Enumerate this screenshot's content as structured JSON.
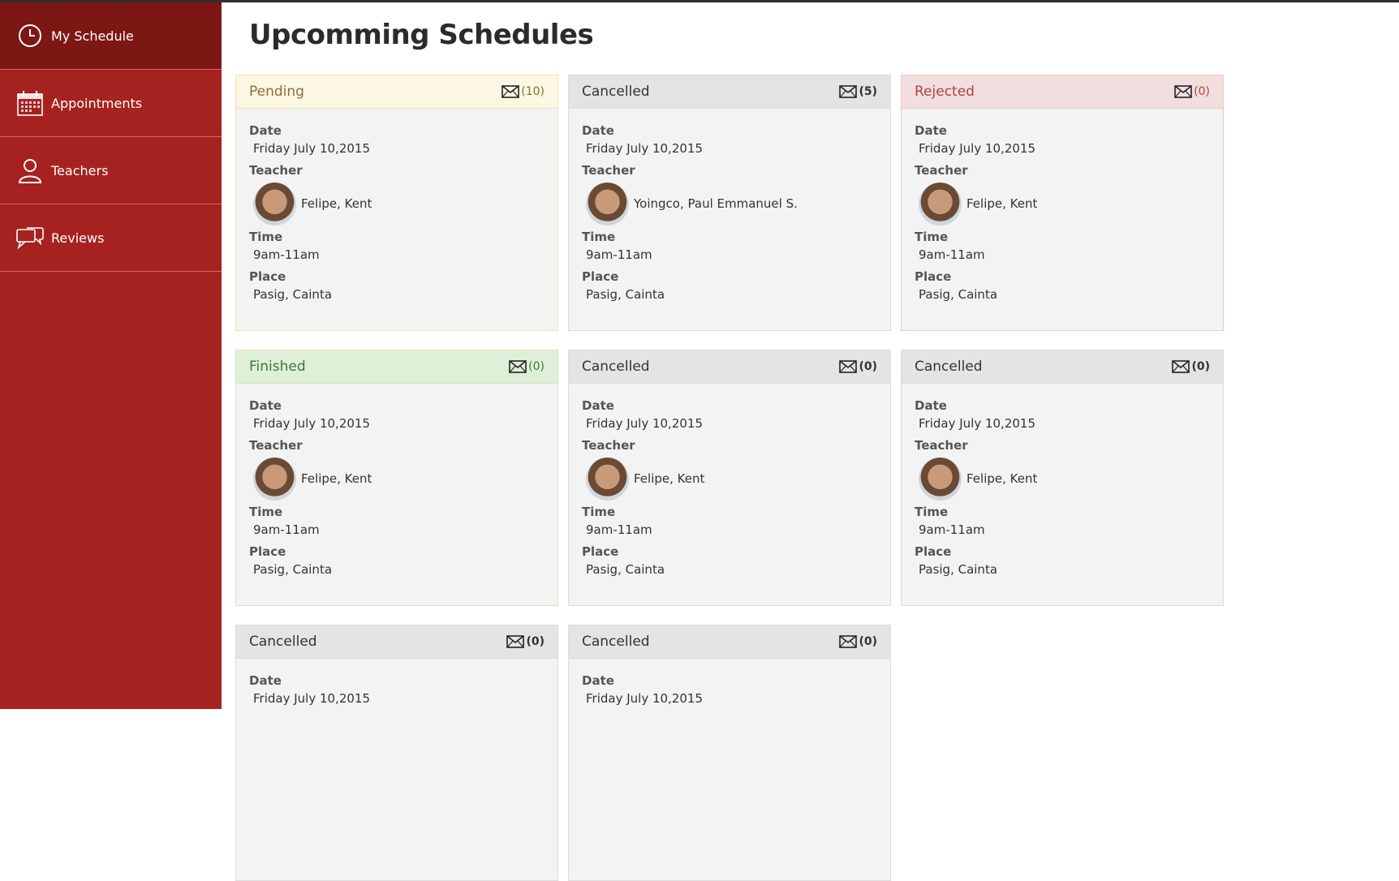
{
  "sidebar": {
    "items": [
      {
        "label": "My Schedule",
        "icon": "clock-icon",
        "active": true
      },
      {
        "label": "Appointments",
        "icon": "calendar-icon",
        "active": false
      },
      {
        "label": "Teachers",
        "icon": "user-icon",
        "active": false
      },
      {
        "label": "Reviews",
        "icon": "chat-bubbles-icon",
        "active": false
      }
    ]
  },
  "page": {
    "title": "Upcomming Schedules"
  },
  "field_labels": {
    "date": "Date",
    "teacher": "Teacher",
    "time": "Time",
    "place": "Place"
  },
  "colors": {
    "sidebar": "#a52220",
    "sidebar_active": "#7d1714",
    "pending": "#fcf7e3",
    "rejected": "#f2dede",
    "finished": "#dff0d8",
    "cancelled": "#e4e4e4"
  },
  "cards": [
    {
      "status": "Pending",
      "messages": "(10)",
      "date": "Friday July 10,2015",
      "teacher": "Felipe, Kent",
      "time": "9am-11am",
      "place": "Pasig, Cainta"
    },
    {
      "status": "Cancelled",
      "messages": "(5)",
      "date": "Friday July 10,2015",
      "teacher": "Yoingco, Paul Emmanuel S.",
      "time": "9am-11am",
      "place": "Pasig, Cainta"
    },
    {
      "status": "Rejected",
      "messages": "(0)",
      "date": "Friday July 10,2015",
      "teacher": "Felipe, Kent",
      "time": "9am-11am",
      "place": "Pasig, Cainta"
    },
    {
      "status": "Finished",
      "messages": "(0)",
      "date": "Friday July 10,2015",
      "teacher": "Felipe, Kent",
      "time": "9am-11am",
      "place": "Pasig, Cainta"
    },
    {
      "status": "Cancelled",
      "messages": "(0)",
      "date": "Friday July 10,2015",
      "teacher": "Felipe, Kent",
      "time": "9am-11am",
      "place": "Pasig, Cainta"
    },
    {
      "status": "Cancelled",
      "messages": "(0)",
      "date": "Friday July 10,2015",
      "teacher": "Felipe, Kent",
      "time": "9am-11am",
      "place": "Pasig, Cainta"
    },
    {
      "status": "Cancelled",
      "messages": "(0)",
      "date": "Friday July 10,2015"
    },
    {
      "status": "Cancelled",
      "messages": "(0)",
      "date": "Friday July 10,2015"
    }
  ]
}
